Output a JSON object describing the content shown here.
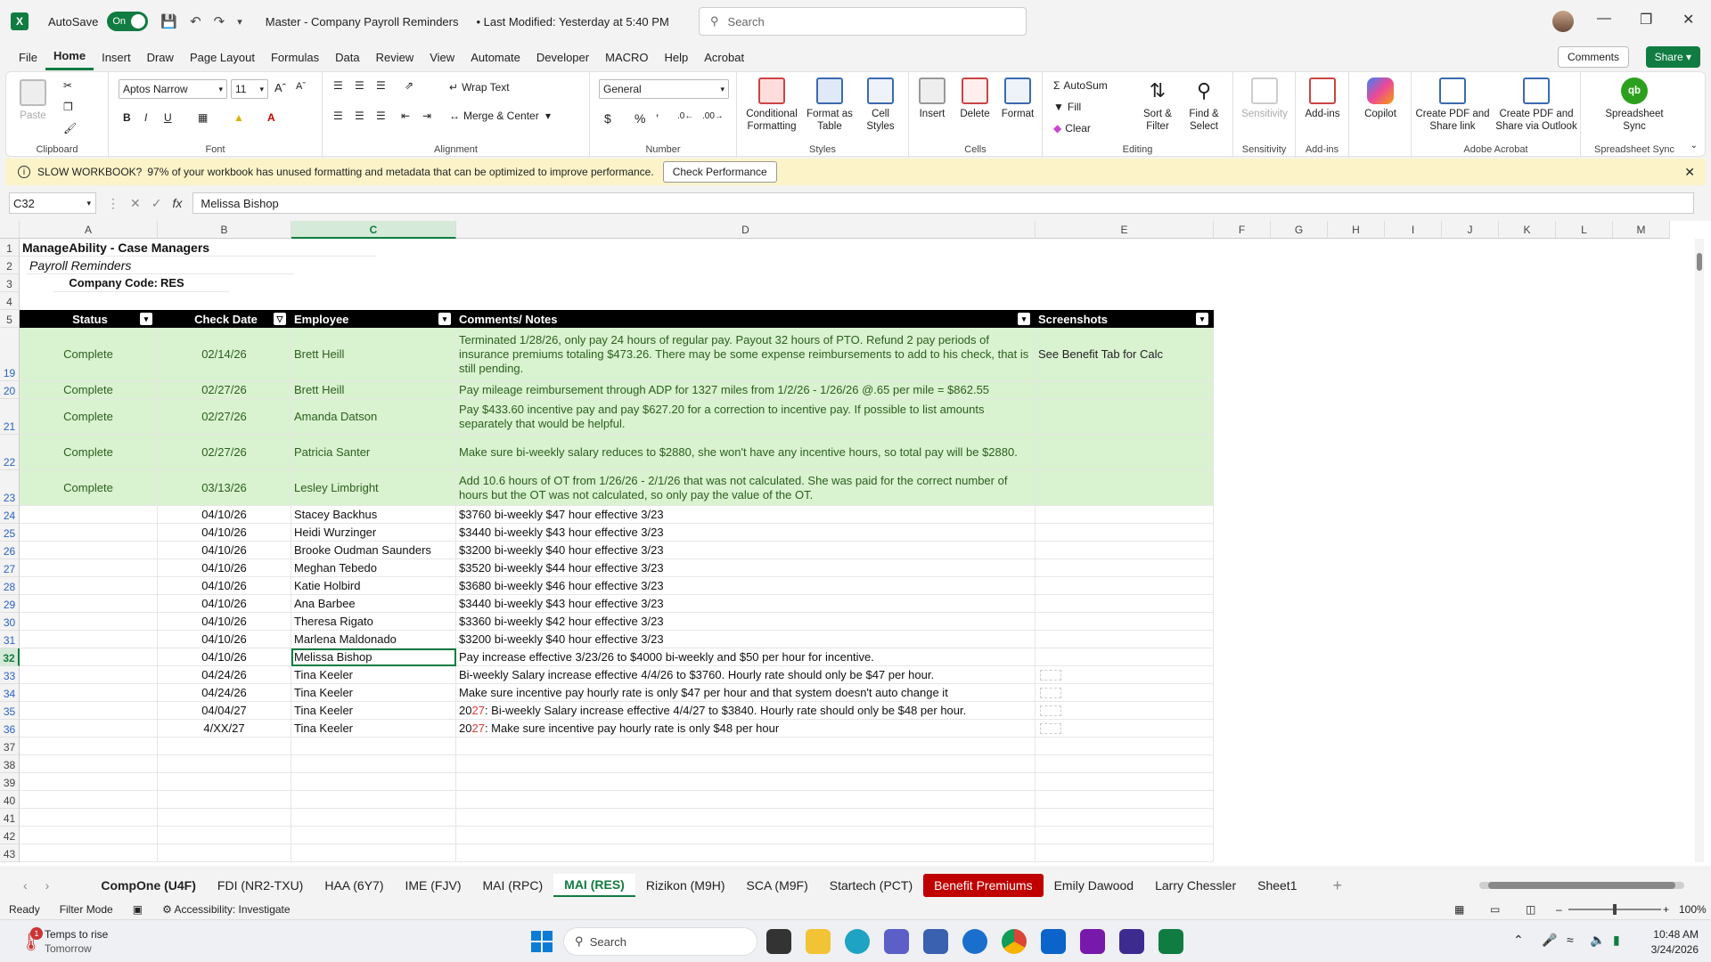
{
  "titlebar": {
    "autosave_label": "AutoSave",
    "autosave_state": "On",
    "document_title": "Master - Company Payroll Reminders",
    "last_modified": "• Last Modified: Yesterday at 5:40 PM",
    "search_placeholder": "Search"
  },
  "menu": {
    "tabs": [
      "File",
      "Home",
      "Insert",
      "Draw",
      "Page Layout",
      "Formulas",
      "Data",
      "Review",
      "View",
      "Automate",
      "Developer",
      "MACRO",
      "Help",
      "Acrobat"
    ],
    "active": "Home",
    "comments_label": "Comments",
    "share_label": "Share"
  },
  "ribbon": {
    "clipboard": {
      "label": "Clipboard",
      "paste": "Paste"
    },
    "font": {
      "label": "Font",
      "name": "Aptos Narrow",
      "size": "11"
    },
    "alignment": {
      "label": "Alignment",
      "wrap": "Wrap Text",
      "merge": "Merge & Center"
    },
    "number": {
      "label": "Number",
      "format": "General"
    },
    "styles": {
      "label": "Styles",
      "conditional": "Conditional Formatting",
      "format_table": "Format as Table",
      "cell_styles": "Cell Styles"
    },
    "cells": {
      "label": "Cells",
      "insert": "Insert",
      "delete": "Delete",
      "format": "Format"
    },
    "editing": {
      "label": "Editing",
      "autosum": "AutoSum",
      "fill": "Fill",
      "clear": "Clear",
      "sort": "Sort & Filter",
      "find": "Find & Select"
    },
    "sensitivity": {
      "label": "Sensitivity",
      "btn": "Sensitivity"
    },
    "addins": {
      "label": "Add-ins",
      "btn": "Add-ins"
    },
    "copilot": {
      "btn": "Copilot"
    },
    "acrobat": {
      "label": "Adobe Acrobat",
      "create_pdf_link": "Create PDF and Share link",
      "create_pdf_outlook": "Create PDF and Share via Outlook"
    },
    "sync": {
      "label": "Spreadsheet Sync",
      "btn": "Spreadsheet Sync"
    }
  },
  "message_bar": {
    "title": "SLOW WORKBOOK?",
    "body": "97% of your workbook has unused formatting and metadata that can be optimized to improve performance.",
    "button": "Check Performance"
  },
  "formula_bar": {
    "name_box": "C32",
    "value": "Melissa Bishop"
  },
  "columns": [
    "A",
    "B",
    "C",
    "D",
    "E",
    "F",
    "G",
    "H",
    "I",
    "J",
    "K",
    "L",
    "M"
  ],
  "sheet_header": {
    "title": "ManageAbility - Case Managers",
    "subtitle": "Payroll Reminders",
    "company_code_label": "Company Code:",
    "company_code": "RES"
  },
  "table_headers": [
    "Status",
    "Check Date",
    "Employee",
    "Comments/ Notes",
    "Screenshots"
  ],
  "rows": [
    {
      "num": "19",
      "status": "Complete",
      "date": "02/14/26",
      "employee": "Brett Heill",
      "notes": "Terminated 1/28/26, only pay 24 hours of regular pay. Payout 32 hours of PTO. Refund 2 pay periods of insurance premiums totaling $473.26. There may be some expense reimbursements to add to his check, that is still pending.",
      "screenshot": "See Benefit Tab for Calc"
    },
    {
      "num": "20",
      "status": "Complete",
      "date": "02/27/26",
      "employee": "Brett Heill",
      "notes": "Pay mileage reimbursement through ADP for 1327 miles from 1/2/26 - 1/26/26 @.65 per mile = $862.55",
      "screenshot": ""
    },
    {
      "num": "21",
      "status": "Complete",
      "date": "02/27/26",
      "employee": "Amanda Datson",
      "notes": "Pay $433.60 incentive pay and pay $627.20 for a correction to incentive pay. If possible to list amounts separately that would be helpful.",
      "screenshot": ""
    },
    {
      "num": "22",
      "status": "Complete",
      "date": "02/27/26",
      "employee": "Patricia Santer",
      "notes": "Make sure bi-weekly salary reduces to $2880, she won't have any incentive hours, so total pay will be $2880.",
      "screenshot": ""
    },
    {
      "num": "23",
      "status": "Complete",
      "date": "03/13/26",
      "employee": "Lesley Limbright",
      "notes": "Add 10.6 hours of OT from 1/26/26 - 2/1/26 that was not calculated. She was paid for the correct number of hours but the OT was not calculated, so only pay the value of the OT.",
      "screenshot": ""
    },
    {
      "num": "24",
      "status": "",
      "date": "04/10/26",
      "employee": "Stacey Backhus",
      "notes": "$3760 bi-weekly $47 hour effective 3/23",
      "screenshot": ""
    },
    {
      "num": "25",
      "status": "",
      "date": "04/10/26",
      "employee": "Heidi Wurzinger",
      "notes": "$3440 bi-weekly $43 hour effective 3/23",
      "screenshot": ""
    },
    {
      "num": "26",
      "status": "",
      "date": "04/10/26",
      "employee": "Brooke Oudman Saunders",
      "notes": "$3200 bi-weekly $40 hour effective 3/23",
      "screenshot": ""
    },
    {
      "num": "27",
      "status": "",
      "date": "04/10/26",
      "employee": "Meghan Tebedo",
      "notes": "$3520 bi-weekly $44 hour effective 3/23",
      "screenshot": ""
    },
    {
      "num": "28",
      "status": "",
      "date": "04/10/26",
      "employee": "Katie Holbird",
      "notes": "$3680 bi-weekly $46 hour effective 3/23",
      "screenshot": ""
    },
    {
      "num": "29",
      "status": "",
      "date": "04/10/26",
      "employee": "Ana Barbee",
      "notes": "$3440 bi-weekly $43 hour effective 3/23",
      "screenshot": ""
    },
    {
      "num": "30",
      "status": "",
      "date": "04/10/26",
      "employee": "Theresa Rigato",
      "notes": "$3360 bi-weekly $42 hour effective 3/23",
      "screenshot": ""
    },
    {
      "num": "31",
      "status": "",
      "date": "04/10/26",
      "employee": "Marlena Maldonado",
      "notes": "$3200 bi-weekly $40 hour effective 3/23",
      "screenshot": ""
    },
    {
      "num": "32",
      "status": "",
      "date": "04/10/26",
      "employee": "Melissa Bishop",
      "notes": "Pay increase effective 3/23/26 to $4000 bi-weekly and $50 per hour for incentive.",
      "screenshot": ""
    },
    {
      "num": "33",
      "status": "",
      "date": "04/24/26",
      "employee": "Tina Keeler",
      "notes": "Bi-weekly Salary increase effective 4/4/26 to $3760. Hourly rate should only be $47 per hour.",
      "screenshot": "thumb"
    },
    {
      "num": "34",
      "status": "",
      "date": "04/24/26",
      "employee": "Tina Keeler",
      "notes": "Make sure incentive pay hourly rate is only $47 per hour and that system doesn't auto change it",
      "screenshot": "thumb"
    },
    {
      "num": "35",
      "status": "",
      "date": "04/04/27",
      "employee": "Tina Keeler",
      "notes_prefix": "20",
      "notes_red": "27",
      "notes": ": Bi-weekly Salary increase effective 4/4/27 to $3840. Hourly rate should only be $48 per hour.",
      "screenshot": "thumb"
    },
    {
      "num": "36",
      "status": "",
      "date": "4/XX/27",
      "employee": "Tina Keeler",
      "notes_prefix": "20",
      "notes_red": "27",
      "notes": ": Make sure incentive pay hourly rate is only $48 per hour",
      "screenshot": "thumb"
    }
  ],
  "empty_rows": [
    "37",
    "38",
    "39",
    "40",
    "41",
    "42",
    "43"
  ],
  "top_rows": [
    "1",
    "2",
    "3",
    "4",
    "5"
  ],
  "sheet_tabs": [
    "CompOne (U4F)",
    "FDI (NR2-TXU)",
    "HAA (6Y7)",
    "IME (FJV)",
    "MAI (RPC)",
    "MAI (RES)",
    "Rizikon (M9H)",
    "SCA (M9F)",
    "Startech (PCT)",
    "Benefit Premiums",
    "Emily Dawood",
    "Larry Chessler",
    "Sheet1"
  ],
  "active_sheet": "MAI (RES)",
  "status_bar": {
    "ready": "Ready",
    "filter_mode": "Filter Mode",
    "accessibility": "Accessibility: Investigate",
    "zoom": "100%"
  },
  "taskbar": {
    "weather_title": "Temps to rise",
    "weather_sub": "Tomorrow",
    "weather_badge": "1",
    "search_placeholder": "Search",
    "time": "10:48 AM",
    "date": "3/24/2026"
  },
  "colors": {
    "excel_green": "#107c41",
    "complete_row": "#d9f2d0",
    "header_black": "#000000",
    "benefit_tab_red": "#c00000",
    "warning_bar": "#fcf4c8"
  }
}
